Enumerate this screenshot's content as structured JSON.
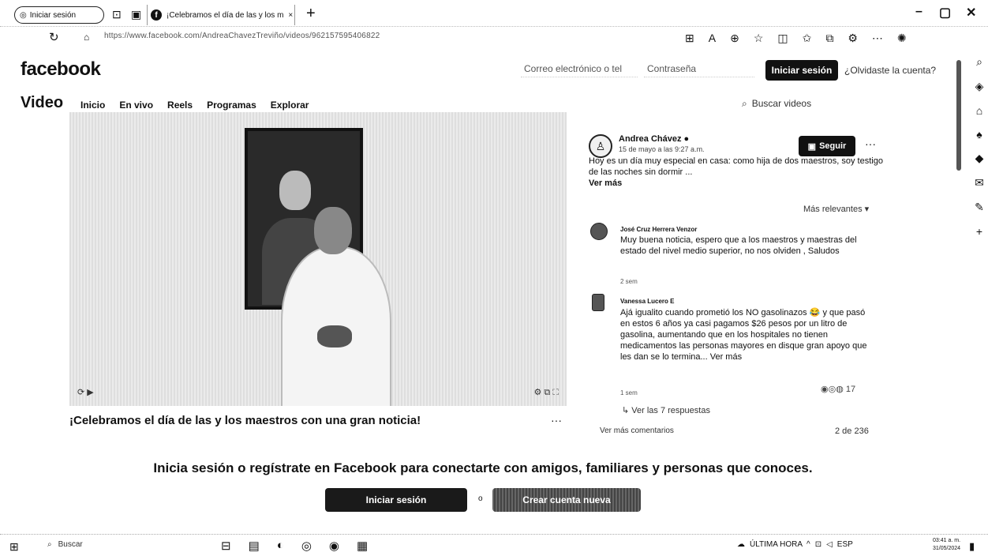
{
  "browser": {
    "profile_label": "Iniciar sesión",
    "tab_title": "¡Celebramos el día de las y los m",
    "tab_close": "×",
    "new_tab": "+",
    "minimize": "–",
    "restore": "▢",
    "close": "✕",
    "url": "https://www.facebook.com/AndreaChavezTreviño/videos/962157595406822"
  },
  "fb": {
    "logo": "facebook",
    "email_placeholder": "Correo electrónico o tel",
    "password_placeholder": "Contraseña",
    "login_button": "Iniciar sesión",
    "forgot": "¿Olvidaste la cuenta?"
  },
  "video_nav": {
    "title": "Video",
    "items": [
      "Inicio",
      "En vivo",
      "Reels",
      "Programas",
      "Explorar"
    ],
    "search": "Buscar videos"
  },
  "post": {
    "video_title": "¡Celebramos el día de las y los maestros con una gran noticia!",
    "more": "···",
    "author": "Andrea Chávez",
    "date": "15 de mayo a las 9:27 a.m.",
    "follow": "Seguir",
    "text": "Hoy es un día muy especial en casa: como hija de dos maestros, soy testigo de las noches sin dormir ...",
    "see_more": "Ver más",
    "sort": "Más relevantes ▾"
  },
  "comments": [
    {
      "name": "José Cruz Herrera Venzor",
      "text": "Muy buena noticia, espero que a los maestros y maestras del estado del nivel medio superior, no nos olviden , Saludos",
      "time": "2 sem"
    },
    {
      "name": "Vanessa Lucero E",
      "text": "Ajá igualito cuando prometió los NO gasolinazos 😂 y que pasó en estos 6 años ya casi pagamos $26 pesos por un litro de gasolina, aumentando que en los hospitales no tienen medicamentos las personas mayores en disque gran apoyo que les dan se lo termina... Ver más",
      "time": "1 sem",
      "reactions": "17"
    }
  ],
  "replies_link": "↳  Ver las 7 respuestas",
  "more_comments": "Ver más comentarios",
  "pager": "2 de 236",
  "cta": {
    "text": "Inicia sesión o regístrate en Facebook para conectarte con amigos, familiares y personas que conoces.",
    "login": "Iniciar sesión",
    "or": "o",
    "create": "Crear cuenta nueva"
  },
  "taskbar": {
    "search": "Buscar",
    "news": "ÚLTIMA HORA",
    "lang": "ESP",
    "time": "03:41 a. m.",
    "date": "31/05/2024"
  }
}
